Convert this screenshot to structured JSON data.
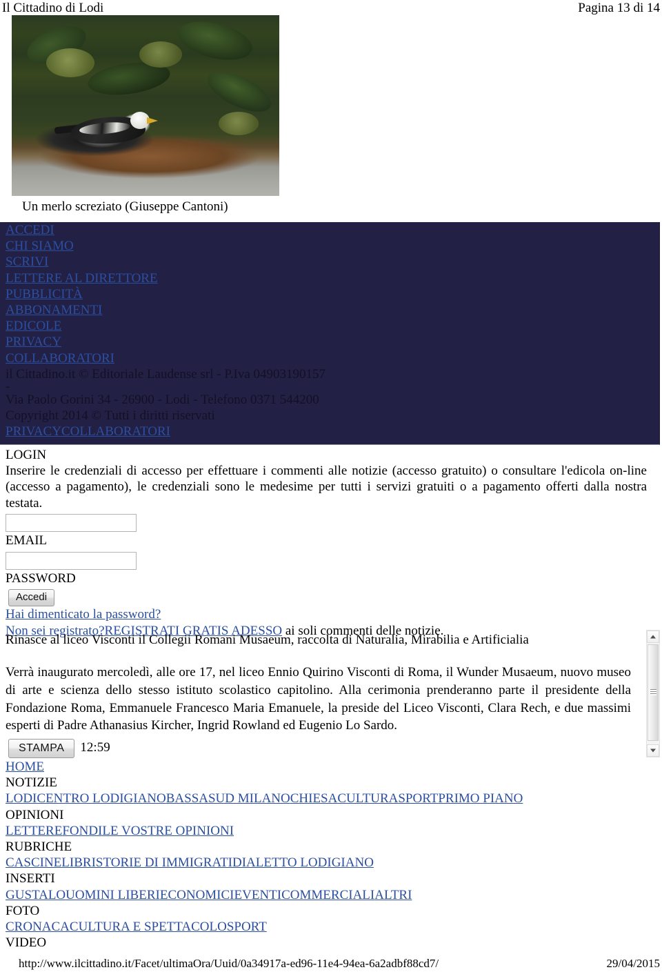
{
  "header": {
    "left": "Il Cittadino di Lodi",
    "right": "Pagina 13 di 14"
  },
  "photo": {
    "alt": "merlo-screziato-photo",
    "caption": "Un merlo screziato (Giuseppe Cantoni)"
  },
  "navy_panel": {
    "background_color": "#232046",
    "link_color": "#2b4fa0",
    "links": [
      "ACCEDI",
      "CHI SIAMO",
      "SCRIVI",
      "LETTERE AL DIRETTORE",
      "PUBBLICITÀ",
      "ABBONAMENTI",
      "EDICOLE",
      "PRIVACY",
      "COLLABORATORI"
    ],
    "copyright_line1": "il Cittadino.it © Editoriale Laudense srl - P.Iva 04903190157",
    "copyright_dash": "-",
    "copyright_line2": "Via Paolo Gorini 34 - 26900 - Lodi - Telefono 0371 544200",
    "copyright_line3": "Copyright 2014 © Tutti i diritti riservati",
    "bottom_links": [
      "PRIVACY",
      "COLLABORATORI"
    ]
  },
  "login": {
    "title": "LOGIN",
    "intro": "Inserire le credenziali di accesso per effettuare i commenti alle notizie (accesso gratuito) o consultare l'edicola on-line (accesso a pagamento), le credenziali sono le medesime per tutti i servizi gratuiti o a pagamento offerti dalla nostra testata.",
    "email_value": "",
    "email_label": "EMAIL",
    "password_value": "",
    "password_label": "PASSWORD",
    "submit_label": "Accedi",
    "forgot_link": "Hai dimenticato la password?",
    "register_prompt": "Non sei registrato?",
    "register_link": "REGISTRATI GRATIS ADESSO",
    "register_suffix": " ai soli commenti delle notizie."
  },
  "article": {
    "headline": "Rinasce al liceo Visconti il Collegii Romani Musaeum, raccolta di Naturalia, Mirabilia e Artificialia",
    "body": "Verrà inaugurato mercoledì, alle ore 17, nel liceo Ennio Quirino Visconti di Roma, il Wunder Musaeum, nuovo museo di arte e scienza dello stesso istituto scolastico capitolino. Alla cerimonia prenderanno parte il presidente della Fondazione Roma, Emmanuele Francesco Maria Emanuele, la preside del Liceo Visconti, Clara Rech, e due massimi esperti di Padre Athanasius Kircher, Ingrid Rowland ed Eugenio Lo Sardo."
  },
  "toolbar": {
    "print_label": "STAMPA",
    "time": "12:59"
  },
  "bottom_nav": {
    "home": "HOME",
    "sections": [
      {
        "heading": "NOTIZIE",
        "links": [
          "LODI",
          "CENTRO LODIGIANO",
          "BASSA",
          "SUD MILANO",
          "CHIESA",
          "CULTURA",
          "SPORT",
          "PRIMO PIANO"
        ]
      },
      {
        "heading": "OPINIONI",
        "links": [
          "LETTERE",
          "FONDI",
          "LE VOSTRE OPINIONI"
        ]
      },
      {
        "heading": "RUBRICHE",
        "links": [
          "CASCINE",
          "LIBRI",
          "STORIE DI IMMIGRATI",
          "DIALETTO LODIGIANO"
        ]
      },
      {
        "heading": "INSERTI",
        "links": [
          "GUSTALO",
          "UOMINI LIBERI",
          "ECONOMICI",
          "EVENTI",
          "COMMERCIALI",
          "ALTRI"
        ]
      },
      {
        "heading": "FOTO",
        "links": [
          "CRONACA",
          "CULTURA E SPETTACOLO",
          "SPORT"
        ]
      },
      {
        "heading": "VIDEO",
        "links": []
      }
    ]
  },
  "footer": {
    "url": "http://www.ilcittadino.it/Facet/ultimaOra/Uuid/0a34917a-ed96-11e4-94ea-6a2adbf88cd7/",
    "date": "29/04/2015"
  }
}
